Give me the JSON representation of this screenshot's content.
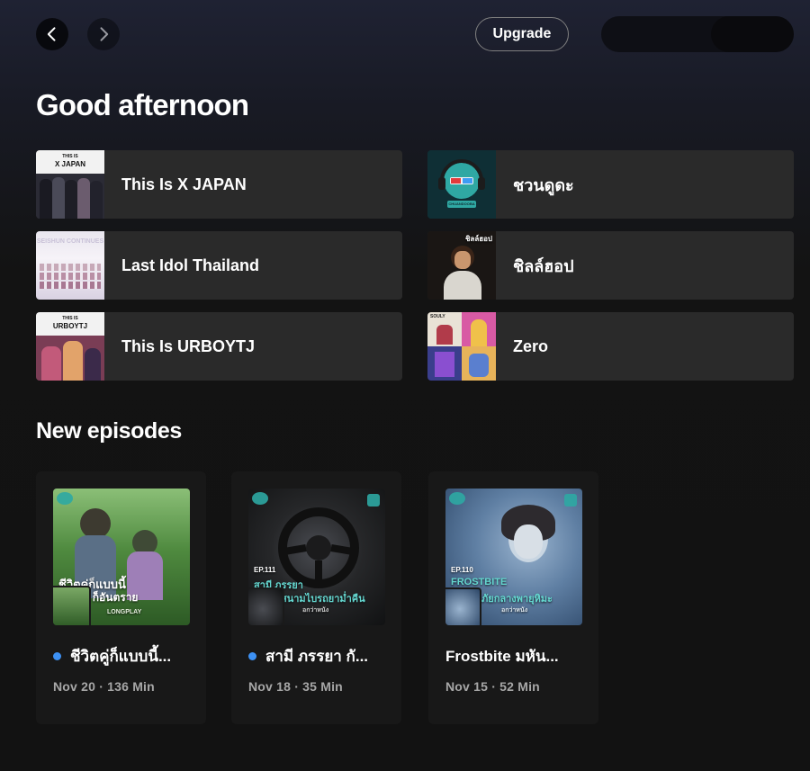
{
  "nav": {
    "back_icon": "chevron-left-icon",
    "forward_icon": "chevron-right-icon",
    "upgrade_label": "Upgrade"
  },
  "home": {
    "greeting": "Good afternoon",
    "shortcuts": [
      {
        "label": "This Is X JAPAN",
        "cover_caption": "X JAPAN",
        "cover_tag": "THIS IS"
      },
      {
        "label": "ชวนดูดะ",
        "cover_caption": "CHUANDOOBA"
      },
      {
        "label": "Last Idol Thailand",
        "cover_caption": "SEISHUN CONTINUES"
      },
      {
        "label": "ชิลล์ฮอป",
        "cover_caption": "ชิลล์ฮอป"
      },
      {
        "label": "This Is URBOYTJ",
        "cover_caption": "URBOYTJ",
        "cover_tag": "THIS IS"
      },
      {
        "label": "Zero",
        "cover_caption": "SOULY"
      }
    ],
    "new_episodes_title": "New episodes",
    "episodes": [
      {
        "title": "ชีวิตคู่ก็แบบนี้...",
        "meta": "Nov 20 · 136 Min",
        "unplayed": true,
        "cover_line1": "ชีวิตคู่ก็แบบนี้",
        "cover_line2": "ๆ ก็อันตราย",
        "cover_tag": "LONGPLAY"
      },
      {
        "title": "สามี ภรรยา กั...",
        "meta": "Nov 18 · 35 Min",
        "unplayed": true,
        "cover_line1": "EP.111",
        "cover_line2": "สามี ภรรยา",
        "cover_line3": "สนามไบรถยาม่ำคืน",
        "cover_tag": "อกว่าหนัง"
      },
      {
        "title": "Frostbite มหัน...",
        "meta": "Nov 15 · 52 Min",
        "unplayed": false,
        "cover_line1": "EP.110",
        "cover_line2": "FROSTBITE",
        "cover_line3": "ภัยกลางพายุหิมะ",
        "cover_tag": "อกว่าหนัง"
      }
    ]
  },
  "colors": {
    "accent_blue": "#3d91f4",
    "card_bg": "#2a2a2a",
    "episode_card_bg": "#181818",
    "muted_text": "#a7a7a7"
  }
}
